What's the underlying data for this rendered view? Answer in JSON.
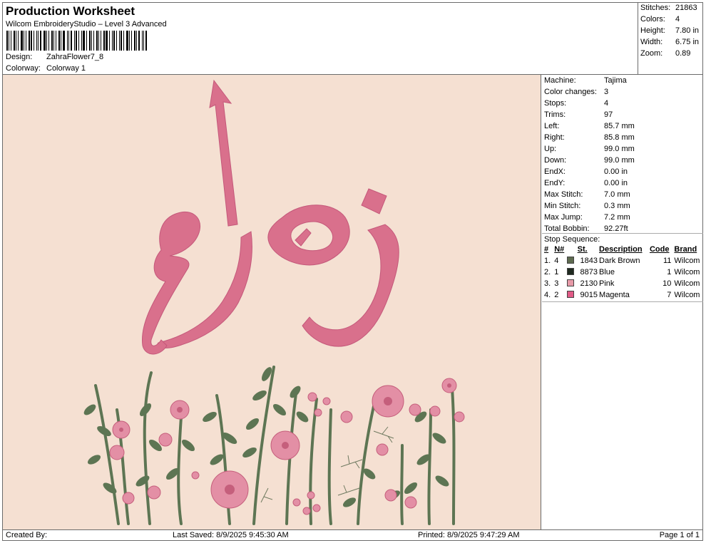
{
  "header": {
    "title": "Production Worksheet",
    "subtitle": "Wilcom EmbroideryStudio – Level 3 Advanced",
    "design_label": "Design:",
    "design_value": "ZahraFlower7_8",
    "colorway_label": "Colorway:",
    "colorway_value": "Colorway 1"
  },
  "stats": {
    "stitches_label": "Stitches:",
    "stitches_value": "21863",
    "colors_label": "Colors:",
    "colors_value": "4",
    "height_label": "Height:",
    "height_value": "7.80 in",
    "width_label": "Width:",
    "width_value": "6.75 in",
    "zoom_label": "Zoom:",
    "zoom_value": "0.89"
  },
  "machine": {
    "machine_label": "Machine:",
    "machine_value": "Tajima",
    "color_changes_label": "Color changes:",
    "color_changes_value": "3",
    "stops_label": "Stops:",
    "stops_value": "4",
    "trims_label": "Trims:",
    "trims_value": "97",
    "left_label": "Left:",
    "left_value": "85.7 mm",
    "right_label": "Right:",
    "right_value": "85.8 mm",
    "up_label": "Up:",
    "up_value": "99.0 mm",
    "down_label": "Down:",
    "down_value": "99.0 mm",
    "endx_label": "EndX:",
    "endx_value": "0.00 in",
    "endy_label": "EndY:",
    "endy_value": "0.00 in",
    "max_stitch_label": "Max Stitch:",
    "max_stitch_value": "7.0 mm",
    "min_stitch_label": "Min Stitch:",
    "min_stitch_value": "0.3 mm",
    "max_jump_label": "Max Jump:",
    "max_jump_value": "7.2 mm",
    "bobbin_label": "Total Bobbin:",
    "bobbin_value": "92.27ft"
  },
  "stop_sequence": {
    "title": "Stop Sequence:",
    "headers": {
      "idx": "#",
      "n": "N#",
      "st": "St.",
      "desc": "Description",
      "code": "Code",
      "brand": "Brand"
    },
    "rows": [
      {
        "idx": "1.",
        "n": "4",
        "color": "#5e6b50",
        "st": "1843",
        "desc": "Dark Brown",
        "code": "11",
        "brand": "Wilcom"
      },
      {
        "idx": "2.",
        "n": "1",
        "color": "#1f2a20",
        "st": "8873",
        "desc": "Blue",
        "code": "1",
        "brand": "Wilcom"
      },
      {
        "idx": "3.",
        "n": "3",
        "color": "#e79aa8",
        "st": "2130",
        "desc": "Pink",
        "code": "10",
        "brand": "Wilcom"
      },
      {
        "idx": "4.",
        "n": "2",
        "color": "#e15a86",
        "st": "9015",
        "desc": "Magenta",
        "code": "7",
        "brand": "Wilcom"
      }
    ]
  },
  "footer": {
    "created": "Created By:",
    "saved": "Last Saved: 8/9/2025 9:45:30 AM",
    "printed": "Printed: 8/9/2025 9:47:29 AM",
    "page": "Page 1 of 1"
  },
  "design": {
    "background": "#f5e0d2",
    "letter_color": "#d9708c",
    "stem_color": "#5d7553",
    "petal_color": "#e38fa5",
    "petal_dark": "#c55f7c"
  }
}
